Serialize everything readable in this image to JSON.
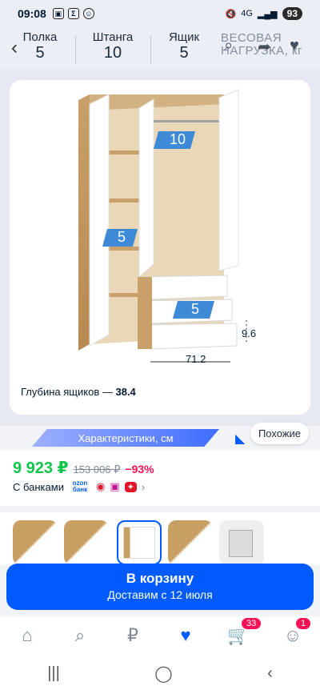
{
  "status": {
    "time": "09:08",
    "battery": "93",
    "network": "4G"
  },
  "header": {
    "stats": [
      {
        "label": "Полка",
        "value": "5"
      },
      {
        "label": "Штанга",
        "value": "10"
      },
      {
        "label": "Ящик",
        "value": "5"
      }
    ],
    "heavy_label": "ВЕСОВАЯ НАГРУЗКА, кг"
  },
  "image": {
    "badges": {
      "top": "10",
      "middle": "5",
      "drawer": "5"
    },
    "dim_width": "71.2",
    "dim_height": "9.6",
    "depth_label": "Глубина ящиков —",
    "depth_value": "38.4"
  },
  "characteristics_label": "Характеристики, см",
  "similar_label": "Похожие",
  "price": {
    "current": "9 923 ₽",
    "old": "153 006 ₽",
    "discount": "−93%"
  },
  "banks_label": "С банками",
  "ozon_bank_text": "ozon банк",
  "cart": {
    "title": "В корзину",
    "subtitle": "Доставим с 12 июля"
  },
  "nav": {
    "cart_badge": "33",
    "profile_badge": "1"
  },
  "colors": {
    "accent": "#005bff",
    "price": "#10c44c",
    "discount": "#f91155"
  }
}
